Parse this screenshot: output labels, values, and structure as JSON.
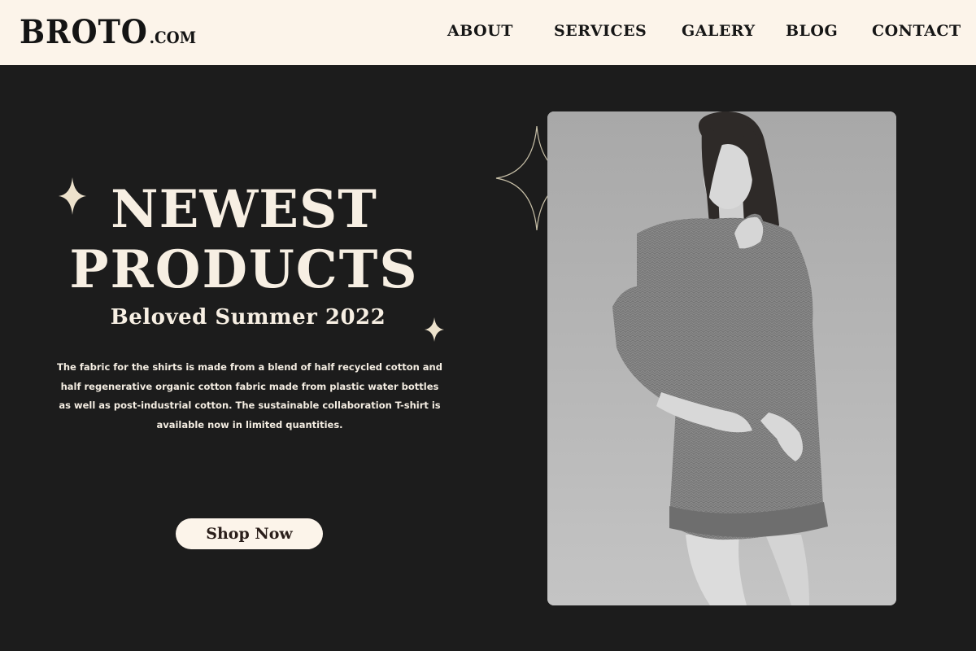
{
  "header": {
    "logo": {
      "main": "BROTO",
      "suffix": ".COM"
    },
    "nav": {
      "about": "ABOUT",
      "services": "SERVICES",
      "galery": "GALERY",
      "blog": "BLOG",
      "contact": "CONTACT"
    }
  },
  "hero": {
    "title_line_1": "NEWEST",
    "title_line_2": "PRODUCTS",
    "subtitle": "Beloved Summer 2022",
    "description": "The fabric for the shirts is made from a blend of half recycled cotton and half regenerative organic cotton fabric made from plastic water bottles as well as post-industrial cotton. The sustainable collaboration T-shirt is available now in limited quantities.",
    "cta_label": "Shop Now"
  },
  "photo": {
    "subject": "model-in-grey-sweater"
  },
  "icons": {
    "sparkle": "sparkle-icon"
  },
  "colors": {
    "background": "#1c1c1c",
    "header_background": "#fcf4ea",
    "text_light": "#f7efe3",
    "text_dark": "#161616",
    "sparkle": "#ede2cc",
    "outline_sparkle": "#c8c0a8"
  }
}
